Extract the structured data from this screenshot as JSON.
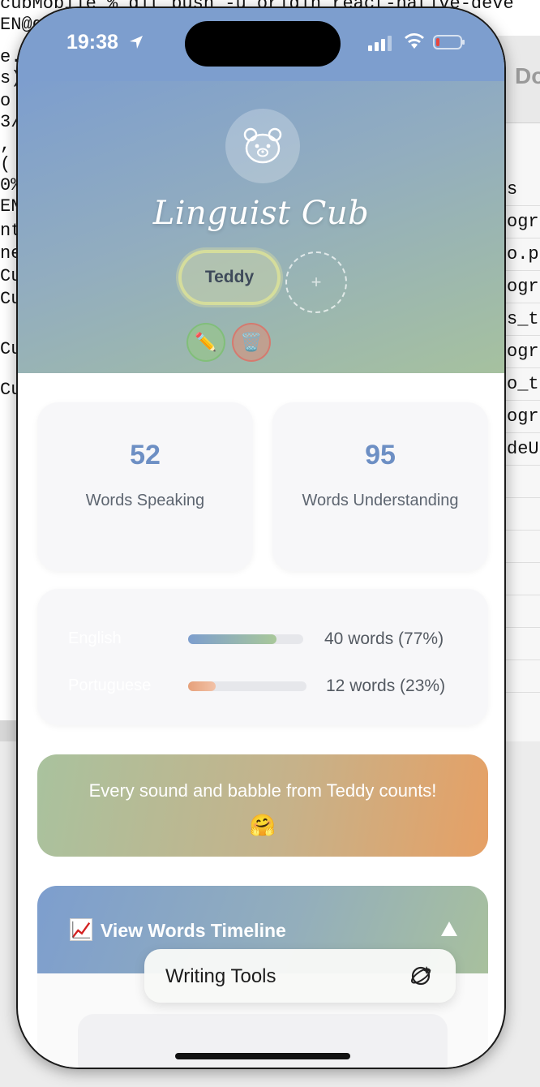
{
  "background": {
    "terminal_top_line": "cubMobile % git push -u origin react-native-deve",
    "terminal_lines": [
      "EN@gi",
      "e.",
      "s)",
      "o",
      "3/",
      ",",
      "(",
      "0%",
      "EN",
      "nt",
      "ne",
      "Cu",
      "Cu",
      "Cu",
      "Cu"
    ],
    "side_panel_header": "Do",
    "side_panel_rows": [
      "s",
      "ogra",
      "o.pr",
      "ogra",
      "s_tr",
      "ogra",
      "o_tr",
      "ogra",
      "deU"
    ]
  },
  "status_bar": {
    "time": "19:38"
  },
  "header": {
    "app_title": "Linguist Cub",
    "selected_child": "Teddy",
    "add_child_symbol": "+",
    "edit_emoji": "✏️",
    "delete_emoji": "🗑️"
  },
  "stats": {
    "speaking": {
      "value": "52",
      "label": "Words Speaking"
    },
    "understanding": {
      "value": "95",
      "label": "Words Understanding"
    }
  },
  "languages": [
    {
      "name": "English",
      "count_text": "40 words (77%)",
      "fraction": 0.77,
      "gradient": [
        "#7d9ece",
        "#a9c89a"
      ]
    },
    {
      "name": "Portuguese",
      "count_text": "12 words (23%)",
      "fraction": 0.23,
      "gradient": [
        "#e6a07a",
        "#f2c2a8"
      ]
    }
  ],
  "encouragement": {
    "text": "Every sound and babble from Teddy counts!",
    "emoji": "🤗"
  },
  "timeline": {
    "icon": "📈",
    "label": "View Words Timeline",
    "toggle_icon": "chevron-up-icon"
  },
  "writing_tools": {
    "label": "Writing Tools"
  },
  "colors": {
    "accent_blue": "#6d8fc4",
    "header_blue": "#7d9ece",
    "header_green": "#a6c19f",
    "orange": "#e6a065"
  }
}
